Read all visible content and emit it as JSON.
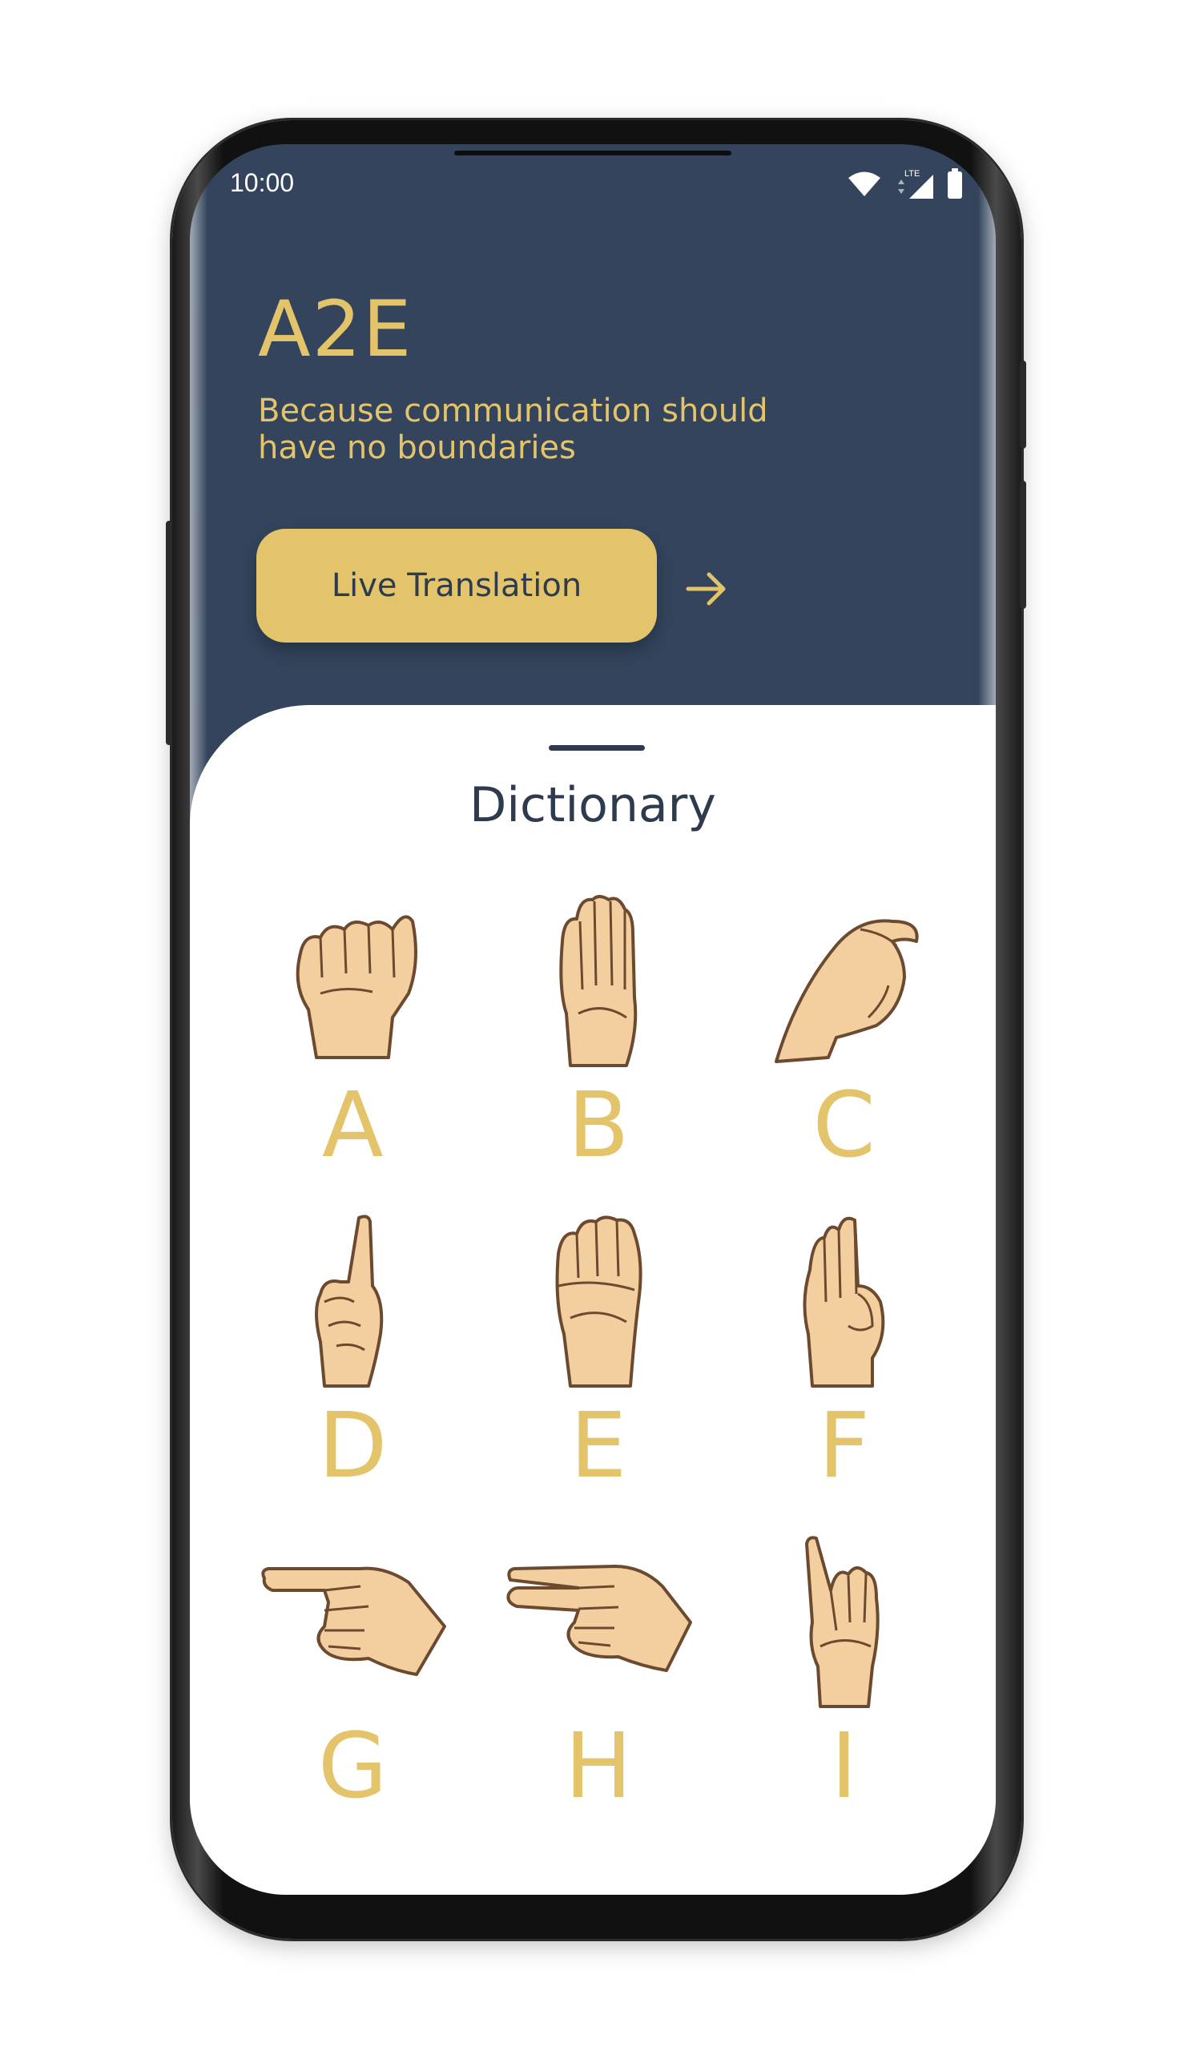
{
  "status_bar": {
    "time": "10:00",
    "network_label": "LTE",
    "icons": [
      "wifi-icon",
      "cell-signal-icon",
      "battery-icon"
    ]
  },
  "header": {
    "app_title": "A2E",
    "tagline": "Because communication should have no boundaries",
    "live_button_label": "Live Translation",
    "arrow_icon": "arrow-right-icon"
  },
  "dictionary": {
    "title": "Dictionary",
    "items": [
      {
        "letter": "A",
        "icon": "hand-sign-a-icon"
      },
      {
        "letter": "B",
        "icon": "hand-sign-b-icon"
      },
      {
        "letter": "C",
        "icon": "hand-sign-c-icon"
      },
      {
        "letter": "D",
        "icon": "hand-sign-d-icon"
      },
      {
        "letter": "E",
        "icon": "hand-sign-e-icon"
      },
      {
        "letter": "F",
        "icon": "hand-sign-f-icon"
      },
      {
        "letter": "G",
        "icon": "hand-sign-g-icon"
      },
      {
        "letter": "H",
        "icon": "hand-sign-h-icon"
      },
      {
        "letter": "I",
        "icon": "hand-sign-i-icon"
      }
    ]
  },
  "colors": {
    "header_bg": "#33445c",
    "accent_gold": "#e3c46a",
    "text_dark": "#2e3b4e",
    "hand_fill": "#f3cfa0",
    "hand_stroke": "#6b4a2f"
  }
}
